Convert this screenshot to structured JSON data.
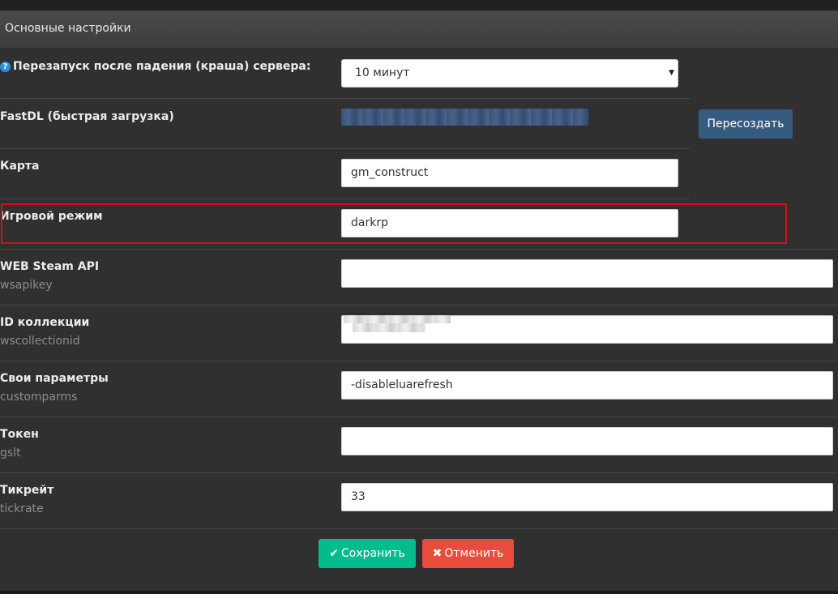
{
  "panel": {
    "title": "Основные настройки"
  },
  "fields": {
    "restart": {
      "label": "Перезапуск после падения (краша) сервера:",
      "help_icon": "question-circle-icon",
      "selected": "10 минут"
    },
    "fastdl": {
      "label": "FastDL (быстрая загрузка)",
      "button": "Пересоздать"
    },
    "map": {
      "label": "Карта",
      "value": "gm_construct"
    },
    "gamemode": {
      "label": "Игровой режим",
      "value": "darkrp"
    },
    "wsapikey": {
      "label": "WEB Steam API",
      "sublabel": "wsapikey",
      "value": ""
    },
    "wscollectionid": {
      "label": "ID коллекции",
      "sublabel": "wscollectionid",
      "value": ""
    },
    "customparms": {
      "label": "Свои параметры",
      "sublabel": "customparms",
      "value": "-disableluarefresh"
    },
    "gslt": {
      "label": "Токен",
      "sublabel": "gslt",
      "value": ""
    },
    "tickrate": {
      "label": "Тикрейт",
      "sublabel": "tickrate",
      "value": "33"
    }
  },
  "actions": {
    "save_label": "Сохранить",
    "save_icon": "check-icon",
    "cancel_label": "Отменить",
    "cancel_icon": "times-icon"
  },
  "colors": {
    "save": "#00bc8c",
    "cancel": "#e74c3c",
    "recreate": "#375a7f",
    "highlight": "#d0101b"
  }
}
